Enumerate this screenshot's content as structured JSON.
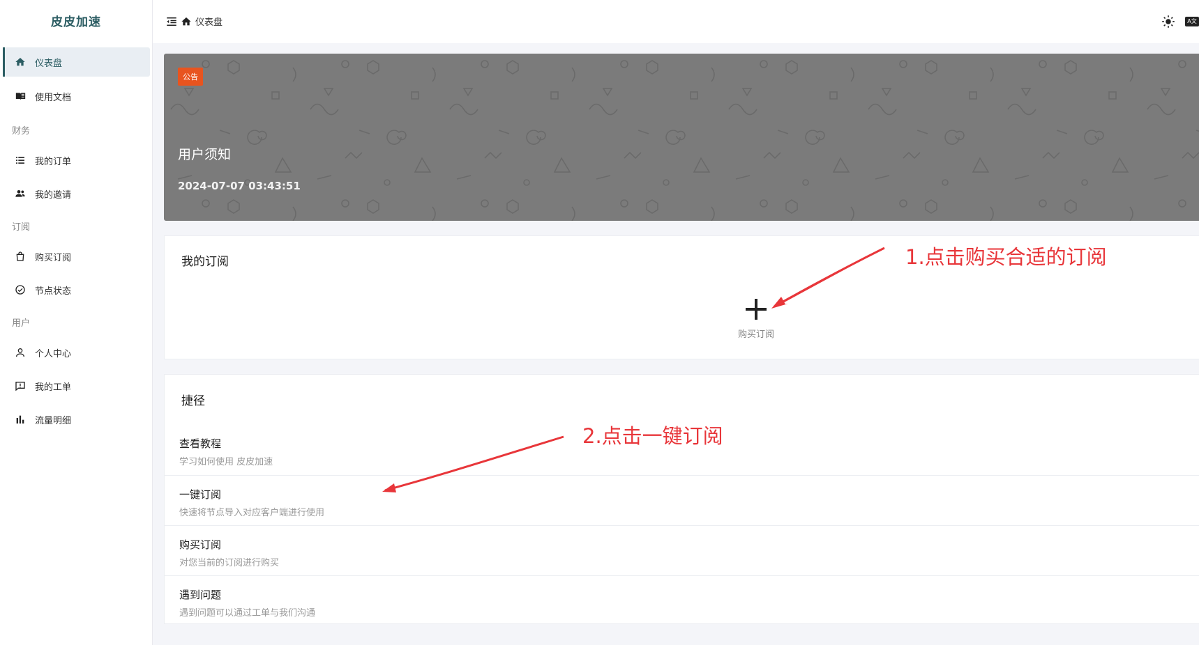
{
  "brand": "皮皮加速",
  "sidebar": {
    "items": [
      {
        "label": "仪表盘",
        "icon": "home-icon"
      },
      {
        "label": "使用文档",
        "icon": "book-icon"
      },
      {
        "label": "我的订单",
        "icon": "list-icon"
      },
      {
        "label": "我的邀请",
        "icon": "users-icon"
      },
      {
        "label": "购买订阅",
        "icon": "bag-icon"
      },
      {
        "label": "节点状态",
        "icon": "check-circle-icon"
      },
      {
        "label": "个人中心",
        "icon": "user-icon"
      },
      {
        "label": "我的工单",
        "icon": "ticket-icon"
      },
      {
        "label": "流量明细",
        "icon": "bar-chart-icon"
      }
    ],
    "sections": [
      "财务",
      "订阅",
      "用户"
    ]
  },
  "header": {
    "breadcrumb": "仪表盘",
    "lang_label": "A文"
  },
  "announcement": {
    "tag": "公告",
    "title": "用户须知",
    "date": "2024-07-07 03:43:51"
  },
  "subscription": {
    "title": "我的订阅",
    "add_label": "购买订阅"
  },
  "shortcuts": {
    "title": "捷径",
    "items": [
      {
        "title": "查看教程",
        "subtitle": "学习如何使用 皮皮加速"
      },
      {
        "title": "一键订阅",
        "subtitle": "快速将节点导入对应客户端进行使用"
      },
      {
        "title": "购买订阅",
        "subtitle": "对您当前的订阅进行购买"
      },
      {
        "title": "遇到问题",
        "subtitle": "遇到问题可以通过工单与我们沟通"
      }
    ]
  },
  "annotations": {
    "step1": "1.点击购买合适的订阅",
    "step2": "2.点击一键订阅"
  },
  "colors": {
    "accent": "#2c5d63",
    "tag": "#e8541f",
    "annotation": "#e8363a",
    "banner": "#7b7b7b"
  }
}
